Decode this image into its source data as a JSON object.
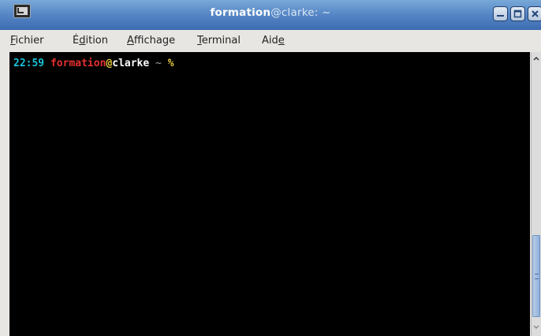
{
  "window": {
    "title_user": "formation",
    "title_host": "@clarke: ~"
  },
  "menu": [
    {
      "pre": "",
      "mn": "F",
      "post": "ichier"
    },
    {
      "pre": "É",
      "mn": "d",
      "post": "ition"
    },
    {
      "pre": "",
      "mn": "A",
      "post": "ffichage"
    },
    {
      "pre": "",
      "mn": "T",
      "post": "erminal"
    },
    {
      "pre": "Aid",
      "mn": "e",
      "post": ""
    }
  ],
  "terminal": {
    "time": "22:59",
    "user": "formation",
    "at": "@",
    "host": "clarke",
    "cwd": "~",
    "symbol": "%"
  },
  "colors": {
    "titlebar": "#4f80c0",
    "terminal_bg": "#000000",
    "time": "#18c3d8",
    "user": "#e53030",
    "host": "#ffffff",
    "symbol": "#e8cc3e"
  },
  "icons": [
    "terminal-app-icon",
    "minimize-icon",
    "maximize-icon",
    "close-icon",
    "scroll-up-arrow-icon",
    "scroll-down-arrow-icon"
  ]
}
